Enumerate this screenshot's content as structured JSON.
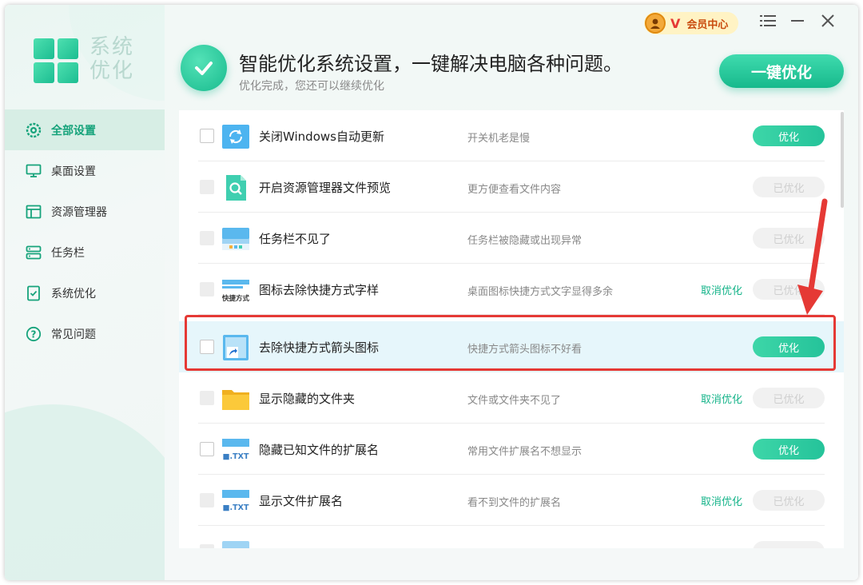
{
  "app": {
    "logo_text": "系统优化"
  },
  "colors": {
    "accent": "#18bb8e",
    "highlight": "#e53935",
    "vip_bg": "#fff3c4"
  },
  "sidebar": {
    "items": [
      {
        "label": "全部设置",
        "icon": "gear-icon",
        "active": true
      },
      {
        "label": "桌面设置",
        "icon": "monitor-icon",
        "active": false
      },
      {
        "label": "资源管理器",
        "icon": "window-icon",
        "active": false
      },
      {
        "label": "任务栏",
        "icon": "taskbar-icon",
        "active": false
      },
      {
        "label": "系统优化",
        "icon": "checklist-icon",
        "active": false
      },
      {
        "label": "常见问题",
        "icon": "question-icon",
        "active": false
      }
    ]
  },
  "header": {
    "headline": "智能优化系统设置，一键解决电脑各种问题。",
    "subline": "优化完成，您还可以继续优化",
    "vip_badge": "V",
    "vip_label": "会员中心",
    "one_click_button": "一键优化"
  },
  "list": {
    "rows": [
      {
        "title": "关闭Windows自动更新",
        "desc": "开关机老是慢",
        "cancel": "",
        "button": "优化",
        "state": "on",
        "icon": "update-icon"
      },
      {
        "title": "开启资源管理器文件预览",
        "desc": "更方便查看文件内容",
        "cancel": "",
        "button": "已优化",
        "state": "off",
        "icon": "file-preview-icon"
      },
      {
        "title": "任务栏不见了",
        "desc": "任务栏被隐藏或出现异常",
        "cancel": "",
        "button": "已优化",
        "state": "off",
        "icon": "taskbar-window-icon"
      },
      {
        "title": "图标去除快捷方式字样",
        "desc": "桌面图标快捷方式文字显得多余",
        "cancel": "取消优化",
        "button": "已优化",
        "state": "off",
        "icon": "shortcut-text-icon",
        "icon_text": "快捷方式"
      },
      {
        "title": "去除快捷方式箭头图标",
        "desc": "快捷方式箭头图标不好看",
        "cancel": "",
        "button": "优化",
        "state": "on",
        "icon": "shortcut-arrow-icon"
      },
      {
        "title": "显示隐藏的文件夹",
        "desc": "文件或文件夹不见了",
        "cancel": "取消优化",
        "button": "已优化",
        "state": "off",
        "icon": "folder-icon"
      },
      {
        "title": "隐藏已知文件的扩展名",
        "desc": "常用文件扩展名不想显示",
        "cancel": "",
        "button": "优化",
        "state": "on",
        "icon": "txt-file-icon",
        "icon_text": "■.TXT"
      },
      {
        "title": "显示文件扩展名",
        "desc": "看不到文件的扩展名",
        "cancel": "取消优化",
        "button": "已优化",
        "state": "off",
        "icon": "txt-file-icon",
        "icon_text": "■.TXT"
      }
    ]
  }
}
